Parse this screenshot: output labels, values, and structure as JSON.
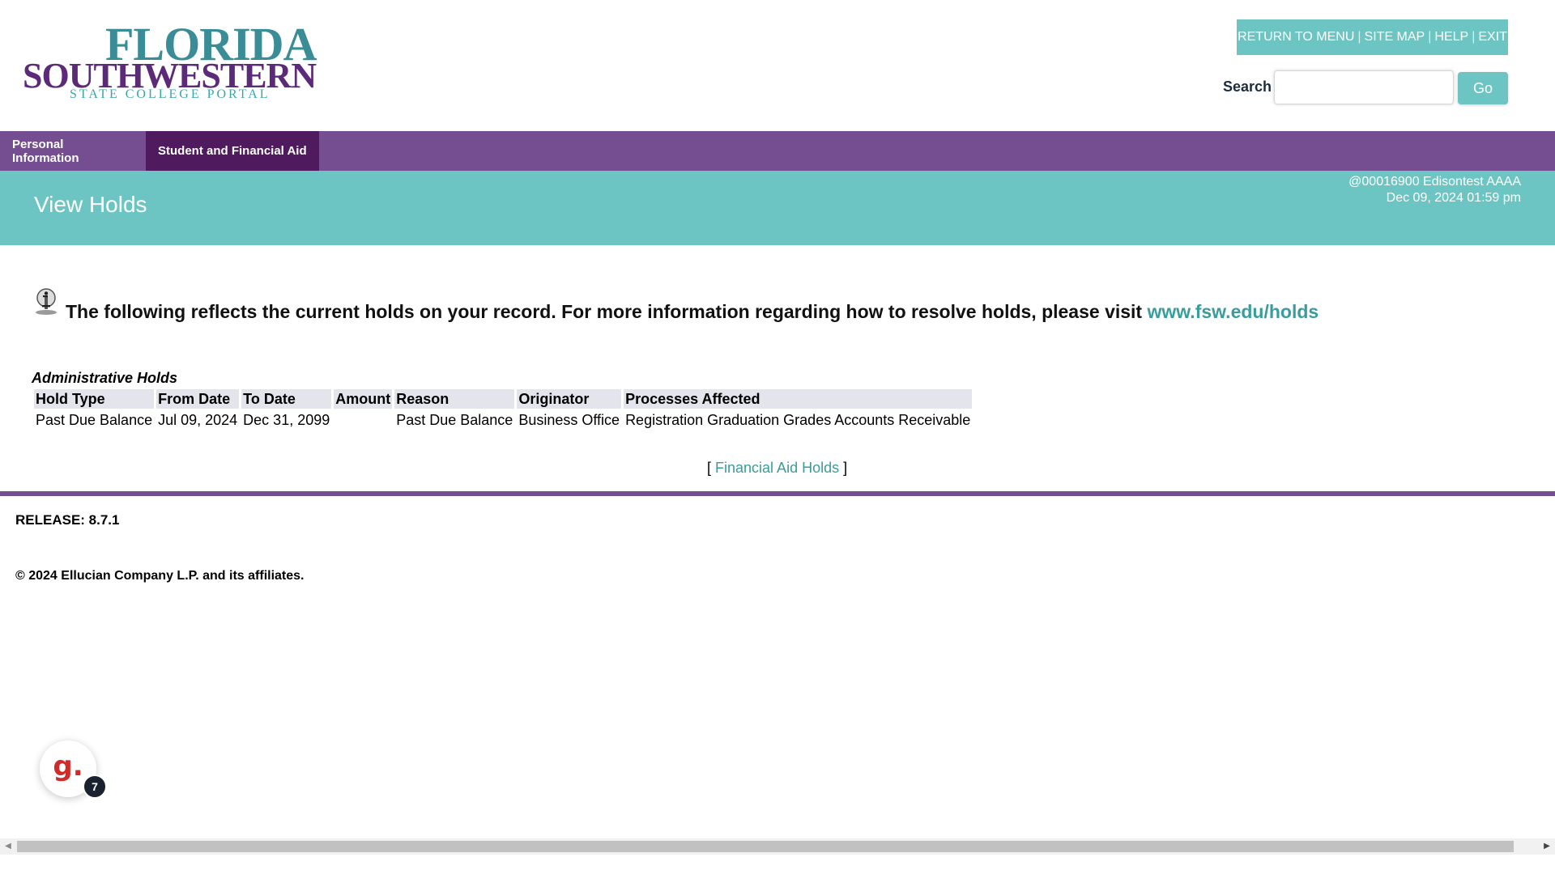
{
  "header": {
    "logo": {
      "line1": "FLORIDA",
      "line2": "SOUTHWESTERN",
      "line3": "STATE COLLEGE PORTAL"
    },
    "topnav": {
      "return_to_menu": "RETURN TO MENU",
      "site_map": "SITE MAP",
      "help": "HELP",
      "exit": "EXIT",
      "separator": "|"
    },
    "search": {
      "label": "Search",
      "value": "",
      "placeholder": "",
      "go_label": "Go"
    }
  },
  "tabs": [
    {
      "label": "Personal Information",
      "active": false
    },
    {
      "label": "Student and Financial Aid",
      "active": true
    }
  ],
  "title_band": {
    "title": "View Holds",
    "user_line": "@00016900 Edisontest AAAA",
    "timestamp": "Dec 09, 2024 01:59 pm"
  },
  "info": {
    "icon": "info-icon",
    "message": "The following reflects the current holds on your record. For more information regarding how to resolve holds, please visit ",
    "link_text": "www.fsw.edu/holds"
  },
  "holds": {
    "caption": "Administrative Holds",
    "columns": [
      "Hold Type",
      "From Date",
      "To Date",
      "Amount",
      "Reason",
      "Originator",
      "Processes Affected"
    ],
    "rows": [
      [
        "Past Due Balance",
        "Jul 09, 2024",
        "Dec 31, 2099",
        "",
        "Past Due Balance",
        "Business Office",
        "Registration Graduation Grades Accounts Receivable"
      ]
    ]
  },
  "fa_link": {
    "open": "[ ",
    "text": "Financial Aid Holds",
    "close": " ]"
  },
  "footer": {
    "release": "RELEASE: 8.7.1",
    "copyright": "© 2024 Ellucian Company L.P. and its affiliates."
  },
  "widget": {
    "glyph": "g.",
    "badge": "7"
  },
  "colors": {
    "teal": "#6cc5c3",
    "purple": "#744e90",
    "dark_purple": "#4f1a5e",
    "link": "#3a9c9c"
  }
}
